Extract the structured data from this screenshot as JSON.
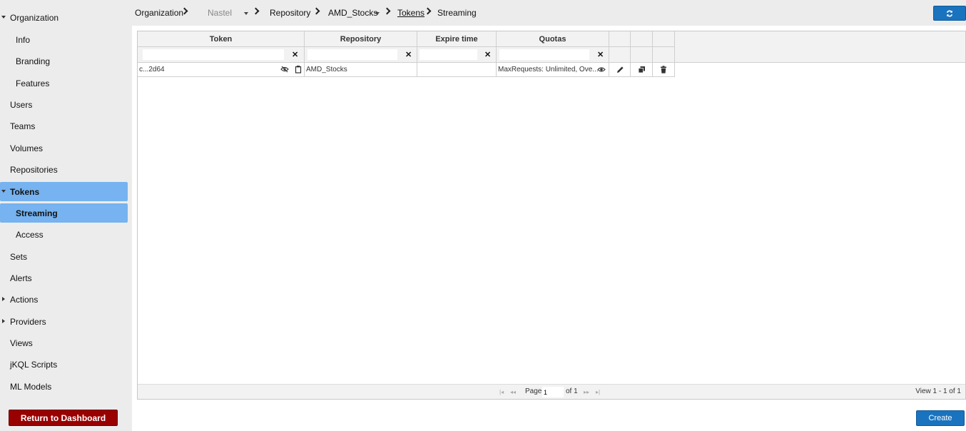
{
  "sidebar": {
    "organization": "Organization",
    "info": "Info",
    "branding": "Branding",
    "features": "Features",
    "users": "Users",
    "teams": "Teams",
    "volumes": "Volumes",
    "repositories": "Repositories",
    "tokens": "Tokens",
    "streaming": "Streaming",
    "access": "Access",
    "sets": "Sets",
    "alerts": "Alerts",
    "actions": "Actions",
    "providers": "Providers",
    "views": "Views",
    "jkql_scripts": "jKQL Scripts",
    "ml_models": "ML Models",
    "return_button": "Return to Dashboard",
    "active_color": "#76b3f0"
  },
  "breadcrumb": {
    "organization": "Organization",
    "org_name": "Nastel",
    "repository": "Repository",
    "repo_name": "AMD_Stocks",
    "tokens": "Tokens",
    "streaming": "Streaming"
  },
  "grid": {
    "columns": [
      "Token",
      "Repository",
      "Expire time",
      "Quotas"
    ],
    "filters": [
      "",
      "",
      "",
      ""
    ],
    "clear_glyph": "✕",
    "rows": [
      {
        "token": "c...2d64",
        "repository": "AMD_Stocks",
        "expire_time": "",
        "quotas": "MaxRequests: Unlimited, Ove..."
      }
    ],
    "pager": {
      "page_label": "Page",
      "page_value": "1",
      "of_label": "of 1",
      "view_label": "View 1 - 1 of 1"
    }
  },
  "actions": {
    "create": "Create",
    "brand_color": "#1a73bf",
    "danger_color": "#990000"
  },
  "icons": [
    "refresh-icon",
    "eye-slash-icon",
    "clipboard-icon",
    "eye-icon",
    "pencil-icon",
    "copy-icon",
    "trash-icon",
    "first-page-icon",
    "prev-page-icon",
    "next-page-icon",
    "last-page-icon"
  ]
}
